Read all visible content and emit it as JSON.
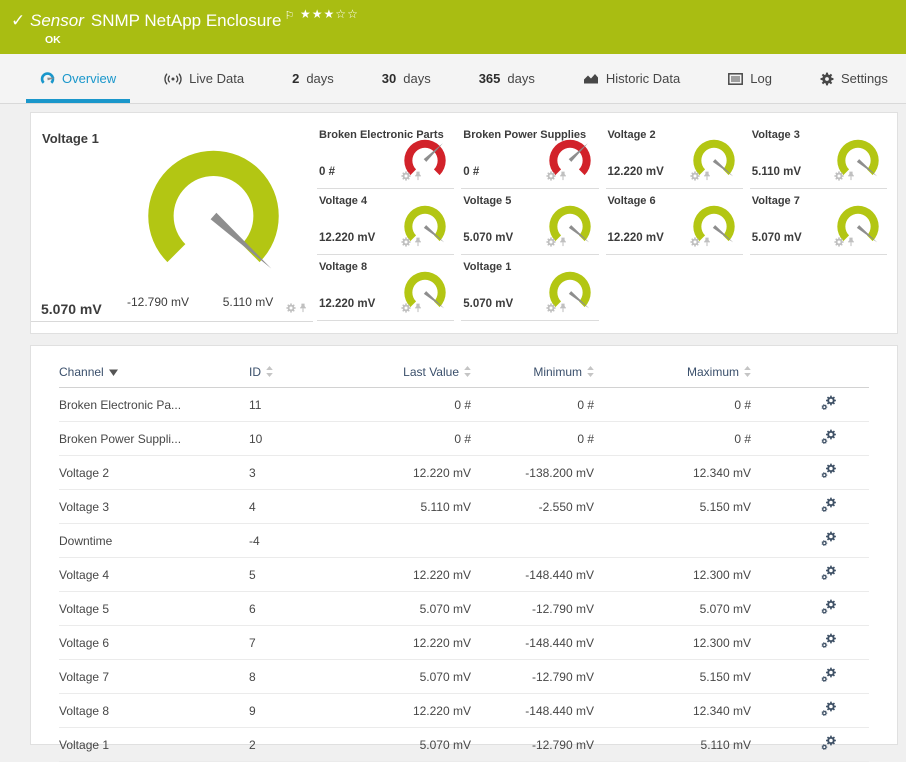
{
  "header": {
    "kind": "Sensor",
    "title": "SNMP NetApp Enclosure",
    "status": "OK",
    "stars_filled": 3,
    "stars_total": 5,
    "icons": {
      "check": "✓",
      "flag": "⚐",
      "star_filled": "★",
      "star_empty": "☆"
    },
    "colors": {
      "bg": "#a9bd12",
      "accent_blue": "#1a97cb"
    }
  },
  "tabs": [
    {
      "label": "Overview",
      "icon": "gauge",
      "active": true
    },
    {
      "label": "Live Data",
      "icon": "live",
      "active": false
    },
    {
      "num": "2",
      "label": "days",
      "active": false
    },
    {
      "num": "30",
      "label": "days",
      "active": false
    },
    {
      "num": "365",
      "label": "days",
      "active": false
    },
    {
      "label": "Historic Data",
      "icon": "chart",
      "active": false
    },
    {
      "label": "Log",
      "icon": "log",
      "active": false
    },
    {
      "label": "Settings",
      "icon": "gear",
      "active": false
    }
  ],
  "gauges": {
    "ok_color": "#b3c613",
    "error_color": "#d2222a",
    "primary": {
      "title": "Voltage 1",
      "value": "5.070 mV",
      "min_label": "-12.790 mV",
      "max_label": "5.110 mV",
      "color": "#b3c613",
      "needle": 0.99
    },
    "mini": [
      {
        "title": "Broken Electronic Parts",
        "value": "0 #",
        "color": "#d2222a",
        "needle": 0.67
      },
      {
        "title": "Broken Power Supplies",
        "value": "0 #",
        "color": "#d2222a",
        "needle": 0.67
      },
      {
        "title": "Voltage 2",
        "value": "12.220 mV",
        "color": "#b3c613",
        "needle": 0.98
      },
      {
        "title": "Voltage 3",
        "value": "5.110 mV",
        "color": "#b3c613",
        "needle": 0.98
      },
      {
        "title": "Voltage 4",
        "value": "12.220 mV",
        "color": "#b3c613",
        "needle": 0.98
      },
      {
        "title": "Voltage 5",
        "value": "5.070 mV",
        "color": "#b3c613",
        "needle": 0.98
      },
      {
        "title": "Voltage 6",
        "value": "12.220 mV",
        "color": "#b3c613",
        "needle": 0.98
      },
      {
        "title": "Voltage 7",
        "value": "5.070 mV",
        "color": "#b3c613",
        "needle": 0.98
      },
      {
        "title": "Voltage 8",
        "value": "12.220 mV",
        "color": "#b3c613",
        "needle": 0.98
      },
      {
        "title": "Voltage 1",
        "value": "5.070 mV",
        "color": "#b3c613",
        "needle": 0.98
      }
    ]
  },
  "table": {
    "columns": [
      {
        "label": "Channel",
        "sort": "desc",
        "align": "left"
      },
      {
        "label": "ID",
        "sort": "both",
        "align": "left"
      },
      {
        "label": "Last Value",
        "sort": "both",
        "align": "right"
      },
      {
        "label": "Minimum",
        "sort": "both",
        "align": "right"
      },
      {
        "label": "Maximum",
        "sort": "both",
        "align": "right"
      },
      {
        "label": "",
        "sort": "none",
        "align": "icon"
      }
    ],
    "rows": [
      {
        "channel": "Broken Electronic Pa...",
        "id": "11",
        "last": "0 #",
        "min": "0 #",
        "max": "0 #"
      },
      {
        "channel": "Broken Power Suppli...",
        "id": "10",
        "last": "0 #",
        "min": "0 #",
        "max": "0 #"
      },
      {
        "channel": "Voltage 2",
        "id": "3",
        "last": "12.220 mV",
        "min": "-138.200 mV",
        "max": "12.340 mV"
      },
      {
        "channel": "Voltage 3",
        "id": "4",
        "last": "5.110 mV",
        "min": "-2.550 mV",
        "max": "5.150 mV"
      },
      {
        "channel": "Downtime",
        "id": "-4",
        "last": "",
        "min": "",
        "max": ""
      },
      {
        "channel": "Voltage 4",
        "id": "5",
        "last": "12.220 mV",
        "min": "-148.440 mV",
        "max": "12.300 mV"
      },
      {
        "channel": "Voltage 5",
        "id": "6",
        "last": "5.070 mV",
        "min": "-12.790 mV",
        "max": "5.070 mV"
      },
      {
        "channel": "Voltage 6",
        "id": "7",
        "last": "12.220 mV",
        "min": "-148.440 mV",
        "max": "12.300 mV"
      },
      {
        "channel": "Voltage 7",
        "id": "8",
        "last": "5.070 mV",
        "min": "-12.790 mV",
        "max": "5.150 mV"
      },
      {
        "channel": "Voltage 8",
        "id": "9",
        "last": "12.220 mV",
        "min": "-148.440 mV",
        "max": "12.340 mV"
      },
      {
        "channel": "Voltage 1",
        "id": "2",
        "last": "5.070 mV",
        "min": "-12.790 mV",
        "max": "5.110 mV"
      }
    ]
  }
}
